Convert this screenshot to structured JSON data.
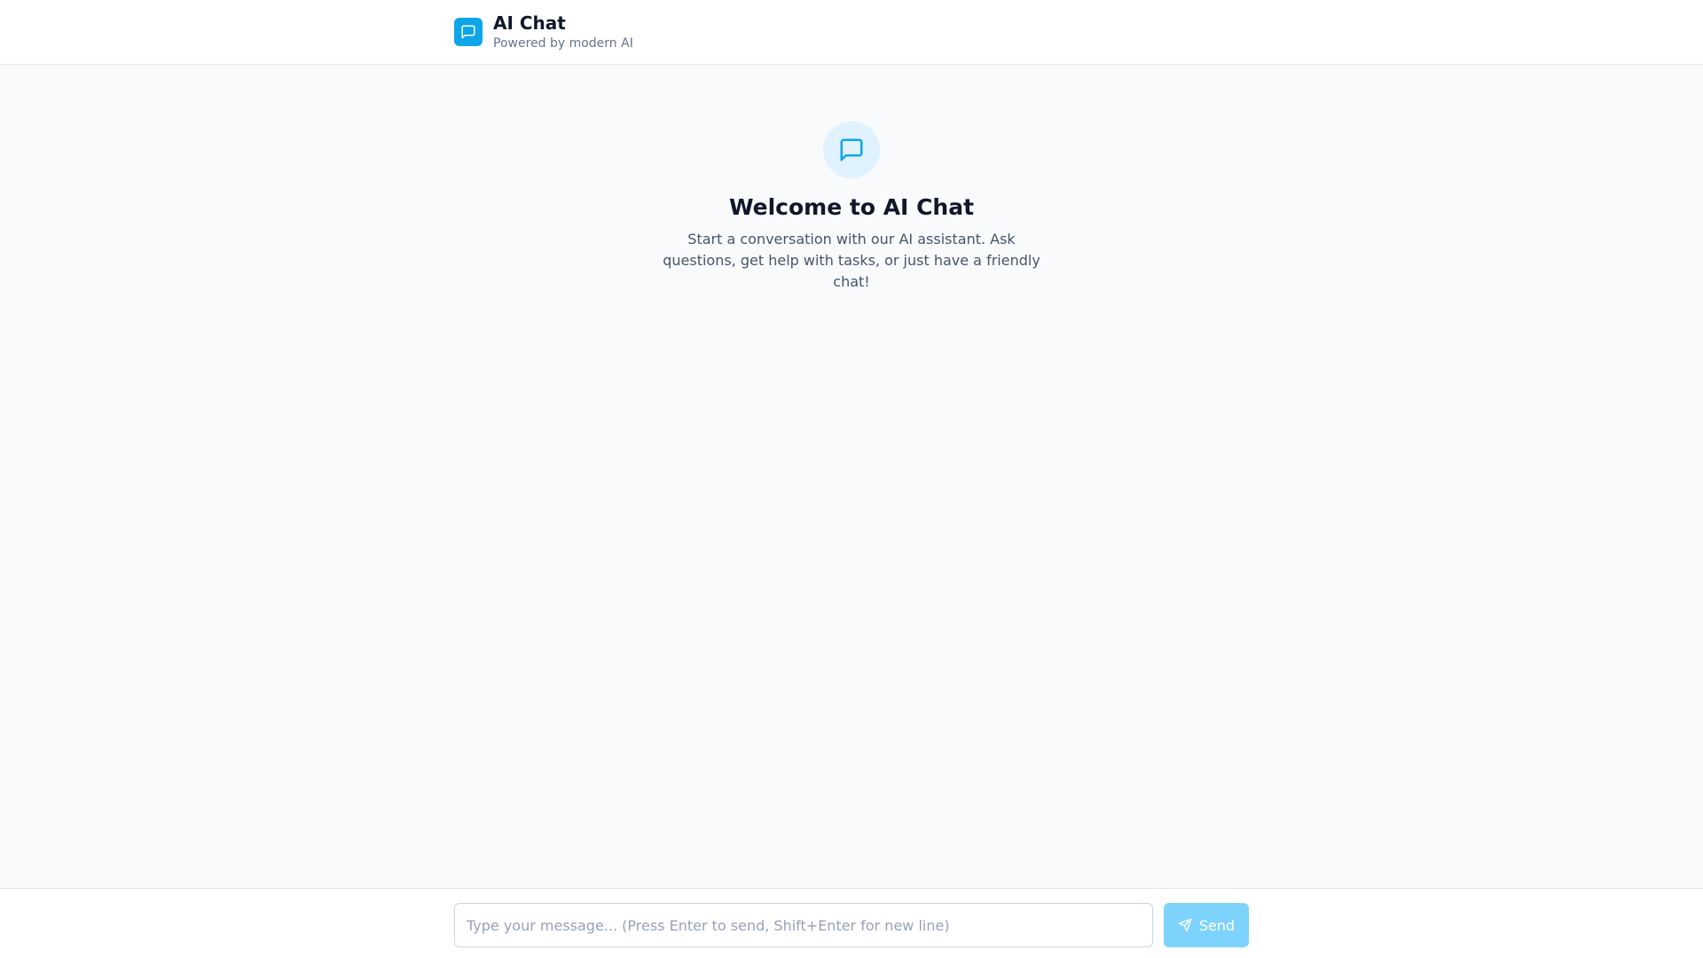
{
  "header": {
    "logo_icon": "message-square-icon",
    "title": "AI Chat",
    "subtitle": "Powered by modern AI"
  },
  "welcome": {
    "icon": "message-square-icon",
    "title": "Welcome to AI Chat",
    "text": "Start a conversation with our AI assistant. Ask questions, get help with tasks, or just have a friendly chat!"
  },
  "composer": {
    "value": "",
    "placeholder": "Type your message... (Press Enter to send, Shift+Enter for new line)",
    "send_label": "Send",
    "send_icon": "send-icon"
  },
  "colors": {
    "accent": "#0ea5e9",
    "accent_light": "#e0f2fe",
    "send_disabled": "#7dd3fc",
    "background": "#f8fafc"
  }
}
